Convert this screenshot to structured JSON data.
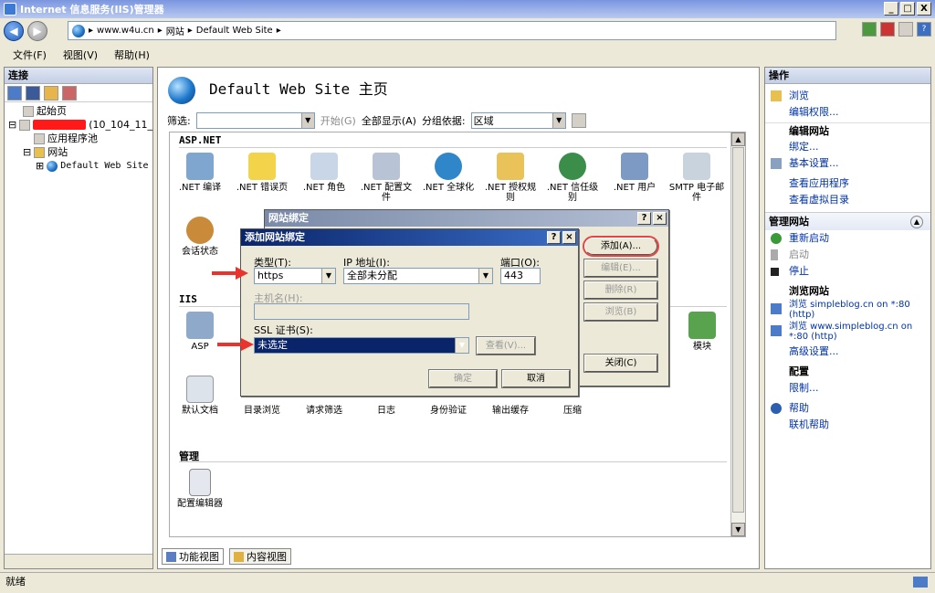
{
  "window": {
    "title": "Internet 信息服务(IIS)管理器",
    "controls": [
      "_",
      "□",
      "X"
    ]
  },
  "address": {
    "segments": [
      "www.w4u.cn",
      "网站",
      "Default Web Site"
    ],
    "separator": "▸"
  },
  "menu": [
    "文件(F)",
    "视图(V)",
    "帮助(H)"
  ],
  "connections": {
    "header": "连接",
    "tree": {
      "start": "起始页",
      "server_suffix": "(10_104_11_",
      "app_pools": "应用程序池",
      "sites": "网站",
      "default_site": "Default Web Site"
    }
  },
  "main": {
    "title": "Default Web Site 主页",
    "filter_label": "筛选:",
    "start_label": "开始(G)",
    "show_all": "全部显示(A)",
    "group_by_label": "分组依据:",
    "group_by_value": "区域",
    "sections": {
      "aspnet": "ASP.NET",
      "iis": "IIS",
      "manage": "管理"
    },
    "aspnet_features": [
      ".NET 编译",
      ".NET 错误页",
      ".NET 角色",
      ".NET 配置文件",
      ".NET 全球化",
      ".NET 授权规则",
      ".NET 信任级别",
      ".NET 用户",
      "SMTP 电子邮件"
    ],
    "aspnet_row2": [
      "会话状态"
    ],
    "iis_features": [
      "ASP",
      "模块"
    ],
    "iis_row2": [
      "默认文档",
      "目录浏览",
      "请求筛选",
      "日志",
      "身份验证",
      "输出缓存",
      "压缩"
    ],
    "manage_features": [
      "配置编辑器"
    ]
  },
  "views": {
    "features": "功能视图",
    "content": "内容视图"
  },
  "actions": {
    "header": "操作",
    "top": [
      "浏览",
      "编辑权限..."
    ],
    "edit_site_header": "编辑网站",
    "edit_site": [
      "绑定...",
      "基本设置...",
      "查看应用程序",
      "查看虚拟目录"
    ],
    "manage_header": "管理网站",
    "manage": [
      "重新启动",
      "启动",
      "停止"
    ],
    "browse_header": "浏览网站",
    "browse_links": [
      "浏览 simpleblog.cn on *:80 (http)",
      "浏览 www.simpleblog.cn on *:80 (http)"
    ],
    "advanced": "高级设置...",
    "config_header": "配置",
    "limits": "限制...",
    "help": "帮助",
    "online_help": "联机帮助"
  },
  "site_bindings": {
    "title": "网站绑定",
    "buttons": {
      "add": "添加(A)...",
      "edit": "编辑(E)...",
      "remove": "删除(R)",
      "browse": "浏览(B)",
      "close": "关闭(C)"
    }
  },
  "add_binding": {
    "title": "添加网站绑定",
    "type_label": "类型(T):",
    "type_value": "https",
    "ip_label": "IP 地址(I):",
    "ip_value": "全部未分配",
    "port_label": "端口(O):",
    "port_value": "443",
    "host_label": "主机名(H):",
    "ssl_label": "SSL 证书(S):",
    "ssl_value": "未选定",
    "view_button": "查看(V)...",
    "ok": "确定",
    "cancel": "取消"
  },
  "status": "就绪",
  "colors": {
    "title_active": "#0a246a",
    "selection": "#0a246a",
    "link": "#0033aa",
    "highlight_ring": "#e04848"
  }
}
